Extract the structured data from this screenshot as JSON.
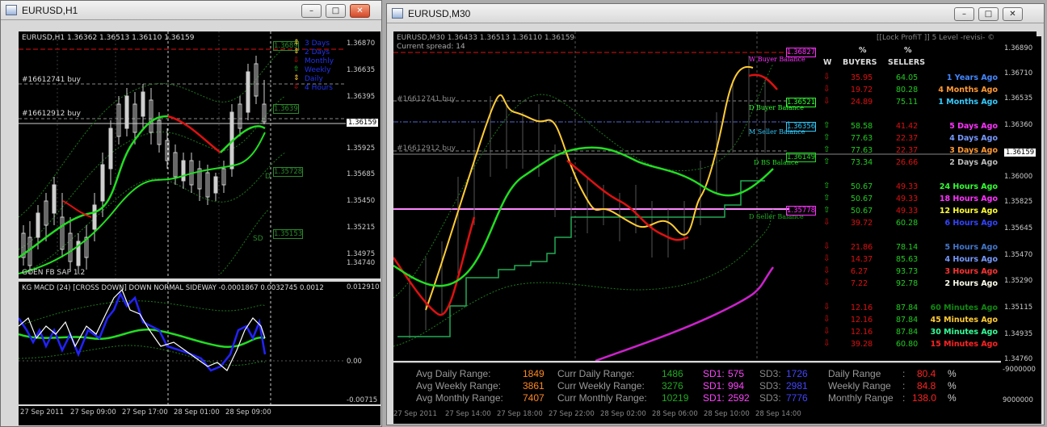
{
  "colors": {
    "up": "#22cc22",
    "down": "#e01010",
    "green_line": "#22dd22",
    "yellow": "#ffcc33",
    "magenta": "#cc22cc",
    "blue": "#2222ff"
  },
  "left_window": {
    "title": "EURUSD,H1",
    "chart_header": "EURUSD,H1  1.36362 1.36513 1.36110 1.36159",
    "order_labels": [
      "#16612741 buy",
      "#16612912 buy"
    ],
    "price_axis": [
      "1.36870",
      "1.36635",
      "1.36395",
      "1.36159",
      "1.35925",
      "1.35685",
      "1.35450",
      "1.35215",
      "1.34975",
      "1.34740"
    ],
    "current_price": "1.36159",
    "level_tags": [
      "1.3689",
      "1.3639",
      "1.35728",
      "1.35153"
    ],
    "level_letters": [
      "D",
      "SD"
    ],
    "timeframe_legend": [
      "3 Days",
      "2 Days",
      "Monthly",
      "Weekly",
      "Daily",
      "4 Hours"
    ],
    "footer_text": "GOEN FB SAP 1.2",
    "macd_header": "KG MACD (24)  [CROSS DOWN]  DOWN  NORMAL  SIDEWAY  -0.0001867 0.0032745 0.0012",
    "macd_axis": [
      "0.012910",
      "0.00",
      "-0.00715"
    ],
    "time_axis": [
      "27 Sep 2011",
      "27 Sep 09:00",
      "27 Sep 17:00",
      "28 Sep 01:00",
      "28 Sep 09:00"
    ]
  },
  "right_window": {
    "title": "EURUSD,M30",
    "chart_header": "EURUSD,M30  1.36433 1.36513 1.36110 1.36159",
    "spread_text": "Current spread: 14",
    "lock_profit": "[[Lock ProfiT ]] 5 Level -revisi- ©",
    "order_labels": [
      "#16612741 buy",
      "#16612912 buy"
    ],
    "price_axis": [
      "1.36890",
      "1.36710",
      "1.36535",
      "1.36360",
      "1.36159",
      "1.36000",
      "1.35825",
      "1.35645",
      "1.35470",
      "1.35290",
      "1.35115",
      "1.34935",
      "1.34760"
    ],
    "lower_axis": [
      "-9000000",
      "9000000"
    ],
    "current_price": "1.36159",
    "balance_tags": [
      {
        "label": "W Buyer Balance",
        "value": "1.36827"
      },
      {
        "label": "D Buyer Balance",
        "value": "1.36521"
      },
      {
        "label": "M Seller Balance",
        "value": "1.36356"
      },
      {
        "label": "D BS Balance",
        "value": "1.36149"
      },
      {
        "label": "D Seller Balance",
        "value": "1.35778"
      }
    ],
    "table_headers": {
      "w": "W",
      "pct1": "%",
      "pct2": "%",
      "buyers": "BUYERS",
      "sellers": "SELLERS"
    },
    "rows": [
      {
        "dir": "down",
        "buy": "35.95",
        "sell": "64.05",
        "period": "1 Years Ago",
        "pcolor": "#4488ff"
      },
      {
        "dir": "down",
        "buy": "19.72",
        "sell": "80.28",
        "period": "4 Months Ago",
        "pcolor": "#ff9933"
      },
      {
        "dir": "down",
        "buy": "24.89",
        "sell": "75.11",
        "period": "1 Months Ago",
        "pcolor": "#33ccff"
      },
      {
        "dir": "up",
        "buy": "58.58",
        "sell": "41.42",
        "period": "5 Days Ago",
        "pcolor": "#ff33ff"
      },
      {
        "dir": "up",
        "buy": "77.63",
        "sell": "22.37",
        "period": "4 Days Ago",
        "pcolor": "#7799ff"
      },
      {
        "dir": "up",
        "buy": "77.63",
        "sell": "22.37",
        "period": "3 Days Ago",
        "pcolor": "#ff9933"
      },
      {
        "dir": "up",
        "buy": "73.34",
        "sell": "26.66",
        "period": "2 Days Ago",
        "pcolor": "#bbbbbb"
      },
      {
        "dir": "up",
        "buy": "50.67",
        "sell": "49.33",
        "period": "24 Hours Ago",
        "pcolor": "#33ff33"
      },
      {
        "dir": "up",
        "buy": "50.67",
        "sell": "49.33",
        "period": "18 Hours Ago",
        "pcolor": "#ff33ff"
      },
      {
        "dir": "up",
        "buy": "50.67",
        "sell": "49.33",
        "period": "12 Hours Ago",
        "pcolor": "#ffff33"
      },
      {
        "dir": "down",
        "buy": "39.72",
        "sell": "60.28",
        "period": "6 Hours Ago",
        "pcolor": "#3344ff"
      },
      {
        "dir": "down",
        "buy": "21.86",
        "sell": "78.14",
        "period": "5 Hours Ago",
        "pcolor": "#4477cc"
      },
      {
        "dir": "down",
        "buy": "14.37",
        "sell": "85.63",
        "period": "4 Hours Ago",
        "pcolor": "#7799ff"
      },
      {
        "dir": "down",
        "buy": "6.27",
        "sell": "93.73",
        "period": "3 Hours Ago",
        "pcolor": "#ff3333"
      },
      {
        "dir": "down",
        "buy": "7.22",
        "sell": "92.78",
        "period": "2 Hours Ago",
        "pcolor": "#ffffee"
      },
      {
        "dir": "down",
        "buy": "12.16",
        "sell": "87.84",
        "period": "60 Minutes Ago",
        "pcolor": "#118811"
      },
      {
        "dir": "down",
        "buy": "12.16",
        "sell": "87.84",
        "period": "45 Minutes Ago",
        "pcolor": "#ffcc33"
      },
      {
        "dir": "down",
        "buy": "12.16",
        "sell": "87.84",
        "period": "30 Minutes Ago",
        "pcolor": "#33ff99"
      },
      {
        "dir": "down",
        "buy": "39.28",
        "sell": "60.80",
        "period": "15 Minutes Ago",
        "pcolor": "#ff2222"
      }
    ],
    "stats": {
      "avg_daily_label": "Avg Daily Range:",
      "avg_daily_value": "1849",
      "avg_weekly_label": "Avg Weekly Range:",
      "avg_weekly_value": "3861",
      "avg_monthly_label": "Avg Monthly Range:",
      "avg_monthly_value": "7407",
      "curr_daily_label": "Curr Daily Range:",
      "curr_daily_value": "1486",
      "curr_weekly_label": "Curr Weekly Range:",
      "curr_weekly_value": "3276",
      "curr_monthly_label": "Curr Monthly Range:",
      "curr_monthly_value": "10219",
      "sd1_label": "SD1:",
      "sd1_values": [
        "575",
        "994",
        "2592"
      ],
      "sd3_label": "SD3:",
      "sd3_values": [
        "1726",
        "2981",
        "7776"
      ],
      "range_labels": [
        "Daily Range",
        "Weekly Range",
        "Monthly Range"
      ],
      "range_colon": ":",
      "range_values": [
        "80.4",
        "84.8",
        "138.0"
      ],
      "pct": "%"
    },
    "time_axis": [
      "27 Sep 2011",
      "27 Sep 14:00",
      "27 Sep 18:00",
      "27 Sep 22:00",
      "28 Sep 02:00",
      "28 Sep 06:00",
      "28 Sep 10:00",
      "28 Sep 14:00"
    ]
  }
}
